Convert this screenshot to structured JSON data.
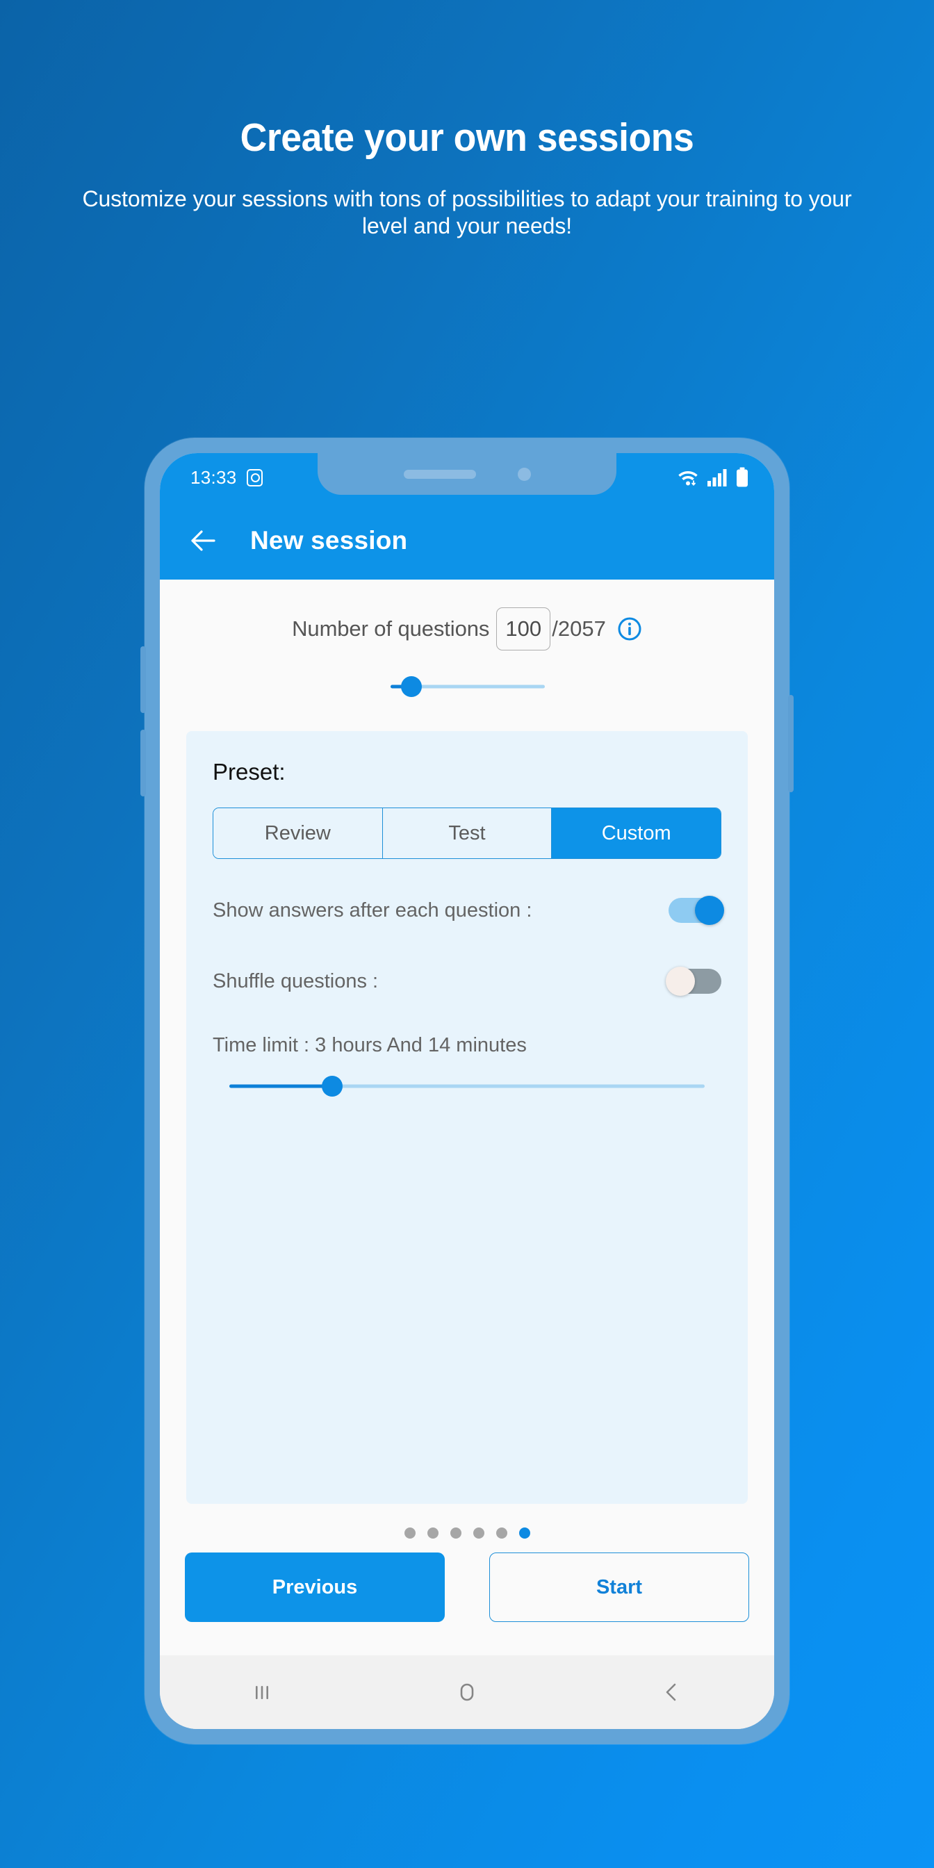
{
  "promo": {
    "title": "Create your own sessions",
    "subtitle": "Customize your sessions with tons of possibilities to adapt your training to your level and your needs!",
    "background_start": "#0b63a8",
    "background_end": "#0b93f5"
  },
  "phone": {
    "bezel_color": "#62a4d8",
    "statusbar": {
      "time": "13:33",
      "icons": [
        "alarm-icon",
        "wifi-icon",
        "signal-icon",
        "battery-icon"
      ],
      "background": "#0d93e8"
    },
    "navbar": {
      "recents": "recents-icon",
      "home": "home-icon",
      "back": "back-icon"
    }
  },
  "appbar": {
    "back_icon": "back-arrow-icon",
    "title": "New session",
    "background": "#0d93e8"
  },
  "questions": {
    "label": "Number of questions",
    "value": "100",
    "placeholder": "100",
    "separator": "/",
    "total": "2057",
    "total_display": "/2057",
    "info_icon": "info-icon",
    "slider": {
      "min": 1,
      "max": 2057,
      "value": 100,
      "percent": 5
    }
  },
  "preset": {
    "label": "Preset:",
    "options": [
      {
        "label": "Review",
        "selected": false
      },
      {
        "label": "Test",
        "selected": false
      },
      {
        "label": "Custom",
        "selected": true
      }
    ],
    "selected": "Custom",
    "accent": "#0d93e8"
  },
  "options": [
    {
      "label": "Show answers after each question :",
      "state": "on"
    },
    {
      "label": "Shuffle questions :",
      "state": "off"
    }
  ],
  "time_limit": {
    "label": "Time limit : 3 hours And 14 minutes",
    "hours": 3,
    "minutes": 14,
    "slider_percent": 30
  },
  "pager": {
    "total": 6,
    "active_index": 5
  },
  "footer": {
    "previous_label": "Previous",
    "start_label": "Start"
  }
}
